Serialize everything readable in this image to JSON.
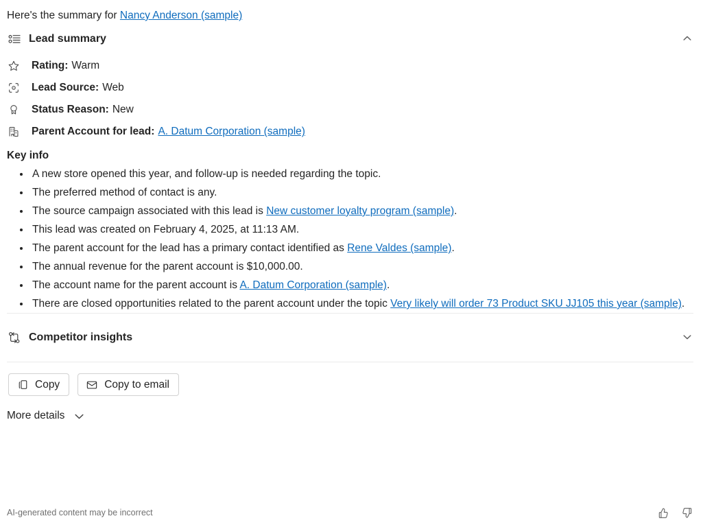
{
  "intro": {
    "prefix": "Here's the summary for ",
    "link_text": "Nancy Anderson (sample)"
  },
  "lead_summary": {
    "icon": "list-summary-icon",
    "title": "Lead summary",
    "expanded": true,
    "chevron": "chevron-up-icon",
    "attributes": [
      {
        "icon": "star-icon",
        "label": "Rating:",
        "value": "Warm"
      },
      {
        "icon": "target-icon",
        "label": "Lead Source:",
        "value": "Web"
      },
      {
        "icon": "ribbon-icon",
        "label": "Status Reason:",
        "value": "New"
      },
      {
        "icon": "building-icon",
        "label": "Parent Account for lead:",
        "value": "",
        "link_text": "A. Datum Corporation (sample)"
      }
    ],
    "key_info_title": "Key info",
    "key_info": [
      {
        "parts": [
          {
            "t": "A new store opened this year, and follow-up is needed regarding the topic.",
            "link": false
          }
        ]
      },
      {
        "parts": [
          {
            "t": "The preferred method of contact is any.",
            "link": false
          }
        ]
      },
      {
        "parts": [
          {
            "t": "The source campaign associated with this lead is ",
            "link": false
          },
          {
            "t": "New customer loyalty program (sample)",
            "link": true
          },
          {
            "t": ".",
            "link": false
          }
        ]
      },
      {
        "parts": [
          {
            "t": "This lead was created on February 4, 2025, at 11:13 AM.",
            "link": false
          }
        ]
      },
      {
        "parts": [
          {
            "t": "The parent account for the lead has a primary contact identified as ",
            "link": false
          },
          {
            "t": "Rene Valdes (sample)",
            "link": true
          },
          {
            "t": ".",
            "link": false
          }
        ]
      },
      {
        "parts": [
          {
            "t": "The annual revenue for the parent account is $10,000.00.",
            "link": false
          }
        ]
      },
      {
        "parts": [
          {
            "t": "The account name for the parent account is ",
            "link": false
          },
          {
            "t": "A. Datum Corporation (sample)",
            "link": true
          },
          {
            "t": ".",
            "link": false
          }
        ]
      },
      {
        "parts": [
          {
            "t": "There are closed opportunities related to the parent account under the topic ",
            "link": false
          },
          {
            "t": "Very likely will order 73 Product SKU JJ105 this year (sample)",
            "link": true
          },
          {
            "t": ".",
            "link": false
          }
        ]
      }
    ]
  },
  "competitor_insights": {
    "icon": "compare-branch-icon",
    "title": "Competitor insights",
    "expanded": false,
    "chevron": "chevron-down-icon"
  },
  "actions": {
    "copy": {
      "icon": "copy-icon",
      "label": "Copy"
    },
    "copy_to_email": {
      "icon": "envelope-icon",
      "label": "Copy to email"
    }
  },
  "more_details": {
    "label": "More details",
    "chevron": "chevron-down-icon"
  },
  "footer": {
    "disclaimer": "AI-generated content may be incorrect",
    "thumbs_up": "thumbs-up-icon",
    "thumbs_down": "thumbs-down-icon"
  },
  "colors": {
    "link": "#0f6cbd",
    "text": "#242424",
    "muted": "#707070",
    "divider": "#ebebeb",
    "icon": "#424242"
  }
}
